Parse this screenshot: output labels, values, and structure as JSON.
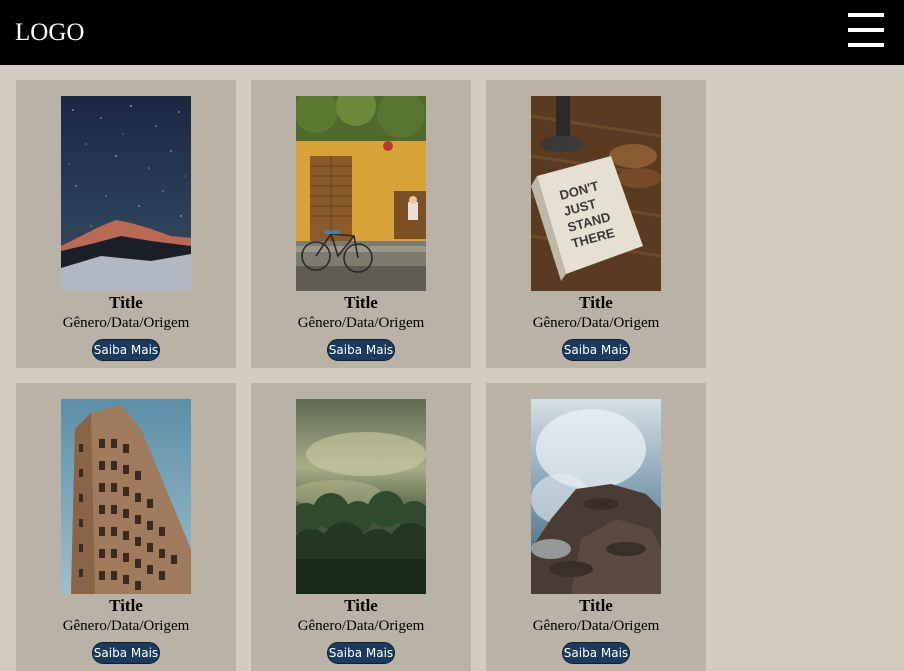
{
  "header": {
    "logo": "LOGO",
    "menu_icon": "hamburger-menu-icon"
  },
  "cards": [
    {
      "title": "Title",
      "meta": "Gênero/Data/Origem",
      "button": "Saiba Mais",
      "image": "starry-sky-mountain"
    },
    {
      "title": "Title",
      "meta": "Gênero/Data/Origem",
      "button": "Saiba Mais",
      "image": "yellow-house-bicycle"
    },
    {
      "title": "Title",
      "meta": "Gênero/Data/Origem",
      "button": "Saiba Mais",
      "image": "notebook-on-table"
    },
    {
      "title": "Title",
      "meta": "Gênero/Data/Origem",
      "button": "Saiba Mais",
      "image": "flatiron-building"
    },
    {
      "title": "Title",
      "meta": "Gênero/Data/Origem",
      "button": "Saiba Mais",
      "image": "misty-forest"
    },
    {
      "title": "Title",
      "meta": "Gênero/Data/Origem",
      "button": "Saiba Mais",
      "image": "wave-on-rocks"
    }
  ],
  "photo_text": {
    "notebook": [
      "DON'T",
      "JUST",
      "STAND",
      "THERE"
    ]
  },
  "colors": {
    "header": "#000000",
    "page_bg": "#d5cbc1",
    "card_bg": "#bab1a7",
    "button_bg": "#1b3a5e",
    "button_text": "#ffffff"
  }
}
